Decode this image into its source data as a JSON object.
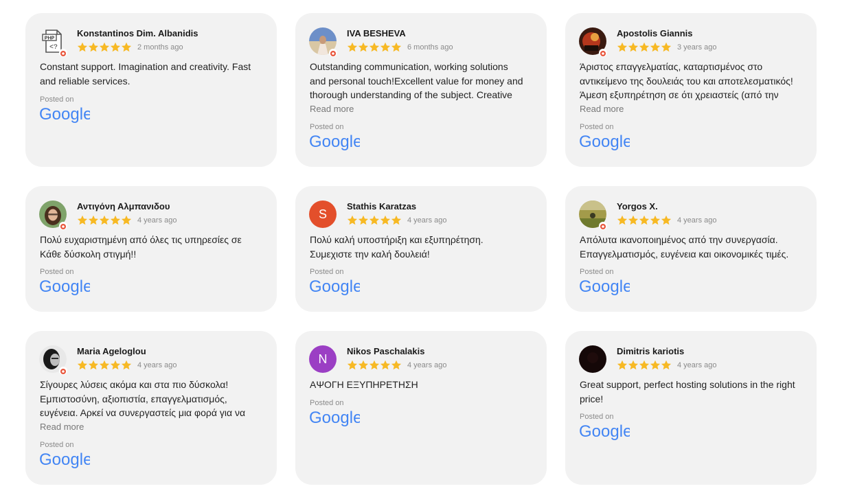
{
  "posted_label": "Posted on",
  "google_label": "Google",
  "read_more_label": "Read more",
  "colors": {
    "card_bg": "#f2f2f2",
    "star": "#f7b924",
    "google_blue": "#4285f4"
  },
  "reviews": [
    {
      "name": "Konstantinos Dim. Albanidis",
      "date": "2 months ago",
      "rating": 5,
      "avatar_icon": "php-file-icon",
      "text_lines": [
        "Constant support. Imagination and creativity. Fast",
        "and reliable services."
      ],
      "read_more": false
    },
    {
      "name": "IVA BESHEVA",
      "date": "6 months ago",
      "rating": 5,
      "avatar_icon": "photo-avatar-beach",
      "text_lines": [
        "Outstanding communication, working solutions",
        "and personal touch!Excellent value for money and",
        "thorough understanding of the subject. Creative"
      ],
      "read_more": true
    },
    {
      "name": "Apostolis Giannis",
      "date": "3 years ago",
      "rating": 5,
      "avatar_icon": "photo-avatar-red",
      "text_lines": [
        "Άριστος επαγγελματίας, καταρτισμένος στο",
        "αντικείμενο της δουλειάς του και αποτελεσματικός!",
        "Άμεση εξυπηρέτηση σε ότι χρειαστείς (από την"
      ],
      "read_more": true
    },
    {
      "name": "Αντιγόνη Αλμπανιδου",
      "date": "4 years ago",
      "rating": 5,
      "avatar_icon": "photo-avatar-woman",
      "text_lines": [
        "Πολύ ευχαριστημένη από όλες τις υπηρεσίες σε",
        "Κάθε δύσκολη στιγμή!!"
      ],
      "read_more": false
    },
    {
      "name": "Stathis Karatzas",
      "date": "4 years ago",
      "rating": 5,
      "avatar_letter": "S",
      "text_lines": [
        "Πολύ καλή υποστήριξη και εξυπηρέτηση.",
        "Συμεχιστε την καλή δουλειά!"
      ],
      "read_more": false
    },
    {
      "name": "Yorgos X.",
      "date": "4 years ago",
      "rating": 5,
      "avatar_icon": "photo-avatar-landscape",
      "text_lines": [
        "Απόλυτα ικανοποιημένος από την συνεργασία.",
        "Επαγγελματισμός, ευγένεια και οικονομικές τιμές."
      ],
      "read_more": false
    },
    {
      "name": "Maria Ageloglou",
      "date": "4 years ago",
      "rating": 5,
      "avatar_icon": "photo-avatar-bw",
      "text_lines": [
        "Σίγουρες λύσεις ακόμα και στα πιο δύσκολα!",
        "Εμπιστοσύνη, αξιοπιστία, επαγγελματισμός,",
        "ευγένεια. Αρκεί να συνεργαστείς μια φορά για να"
      ],
      "read_more": true
    },
    {
      "name": "Nikos Paschalakis",
      "date": "4 years ago",
      "rating": 5,
      "avatar_letter": "N",
      "text_lines": [
        "ΑΨΟΓΗ ΕΞΥΠΗΡΕΤΗΣΗ"
      ],
      "read_more": false
    },
    {
      "name": "Dimitris kariotis",
      "date": "4 years ago",
      "rating": 5,
      "avatar_icon": "photo-avatar-dark",
      "text_lines": [
        "Great support, perfect hosting solutions in the right",
        "price!"
      ],
      "read_more": false
    }
  ]
}
